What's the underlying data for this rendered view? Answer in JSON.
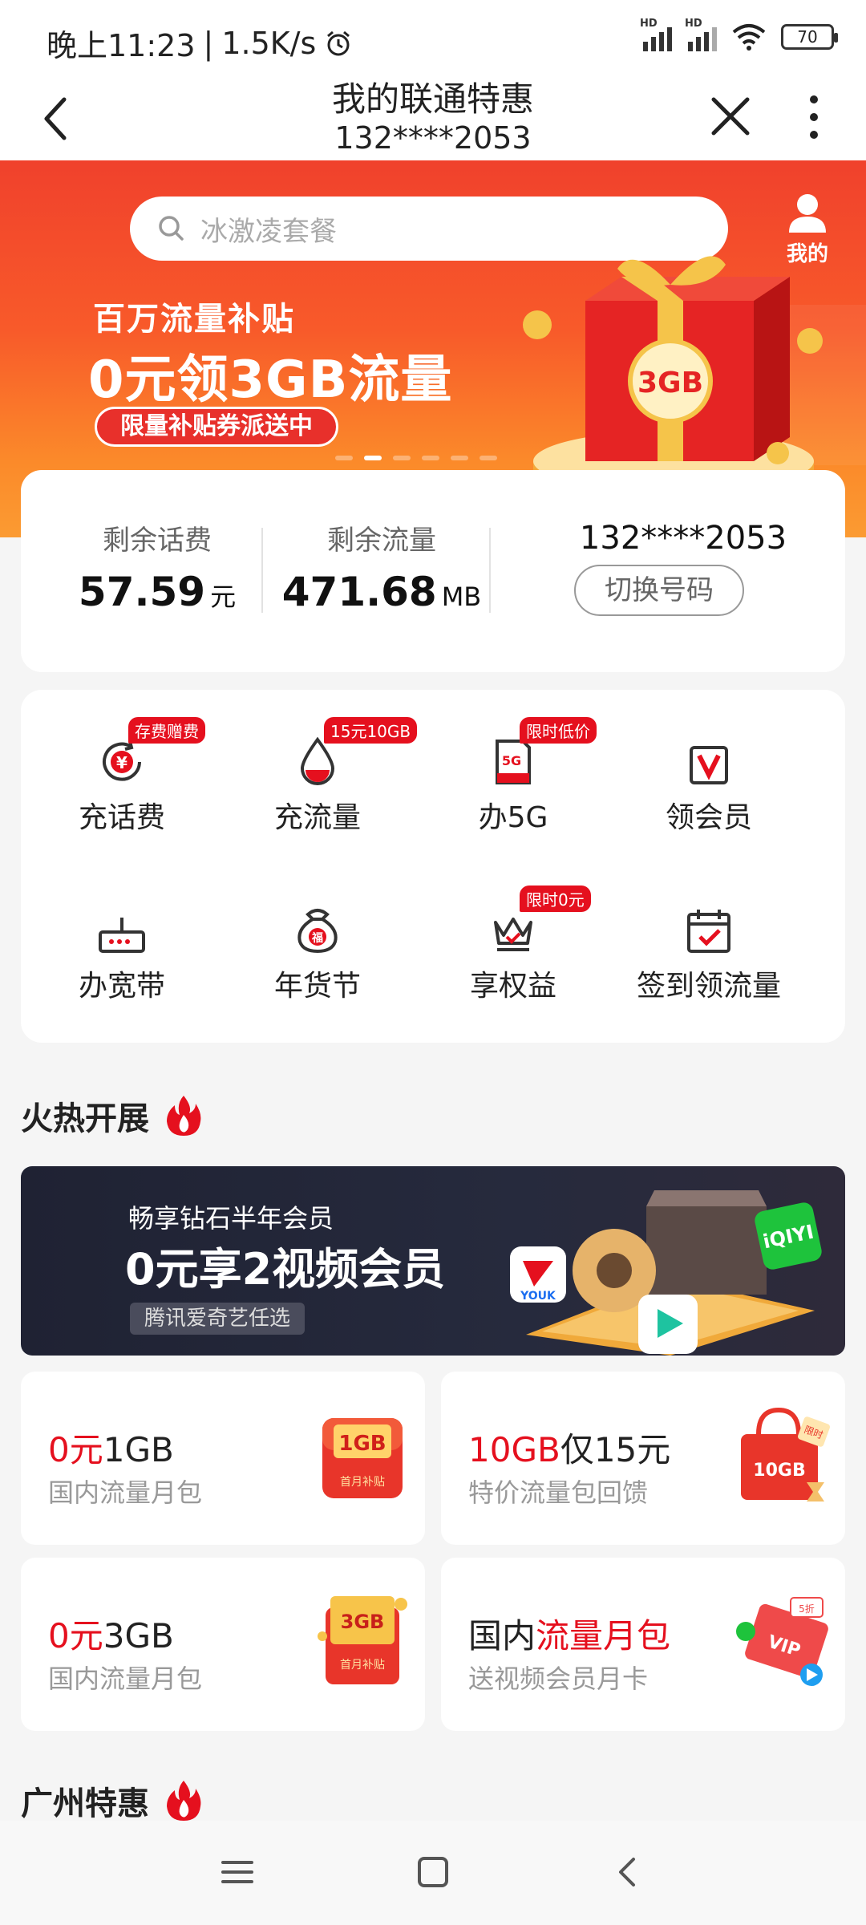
{
  "status_bar": {
    "time": "晚上11:23",
    "speed": "1.5K/s",
    "signal_label": "HD",
    "battery": "70"
  },
  "header": {
    "title": "我的联通特惠",
    "subtitle": "132****2053"
  },
  "banner": {
    "search_placeholder": "冰激凌套餐",
    "me_label": "我的",
    "promo_line1": "百万流量补贴",
    "promo_line2": "0元领3GB流量",
    "promo_pill": "限量补贴券派送中",
    "gift_label": "3GB",
    "active_slide_index": 1,
    "slide_count": 6
  },
  "balance": {
    "fee_label": "剩余话费",
    "fee_value": "57.59",
    "fee_unit": "元",
    "data_label": "剩余流量",
    "data_value": "471.68",
    "data_unit": "MB",
    "phone": "132****2053",
    "switch_label": "切换号码"
  },
  "services": [
    {
      "label": "充话费",
      "tag": "存费赠费",
      "icon": "yuan-recharge-icon"
    },
    {
      "label": "充流量",
      "tag": "15元10GB",
      "icon": "data-drop-icon"
    },
    {
      "label": "办5G",
      "tag": "限时低价",
      "icon": "5g-sim-icon"
    },
    {
      "label": "领会员",
      "tag": "",
      "icon": "vip-v-icon"
    },
    {
      "label": "办宽带",
      "tag": "",
      "icon": "router-icon"
    },
    {
      "label": "年货节",
      "tag": "",
      "icon": "fortune-bag-icon"
    },
    {
      "label": "享权益",
      "tag": "限时0元",
      "icon": "crown-icon"
    },
    {
      "label": "签到领流量",
      "tag": "",
      "icon": "calendar-check-icon"
    }
  ],
  "hot_section": {
    "title": "火热开展"
  },
  "video_banner": {
    "line1": "畅享钻石半年会员",
    "line2": "0元享2视频会员",
    "pill": "腾讯爱奇艺任选",
    "brand_iqiyi": "iQIYI",
    "brand_youku": "YOUK"
  },
  "offers": [
    {
      "main_red": "0元",
      "main_rest": "1GB",
      "sub": "国内流量月包",
      "art_label": "1GB",
      "art_sub": "首月补贴"
    },
    {
      "main_red": "10GB",
      "main_rest": "仅15元",
      "sub": "特价流量包回馈",
      "art_label": "10GB",
      "art_sub": "限时"
    },
    {
      "main_red": "0元",
      "main_rest": "3GB",
      "sub": "国内流量月包",
      "art_label": "3GB",
      "art_sub": "首月补贴"
    },
    {
      "main_pre": "国内",
      "main_red": "流量月包",
      "sub": "送视频会员月卡",
      "art_label": "VIP",
      "art_sub": "5折"
    }
  ],
  "gz_section": {
    "title": "广州特惠"
  },
  "colors": {
    "brand_red": "#e5101e",
    "banner_top": "#f0412c",
    "banner_bottom": "#fb9b32",
    "video_bg": "#1f2233"
  }
}
